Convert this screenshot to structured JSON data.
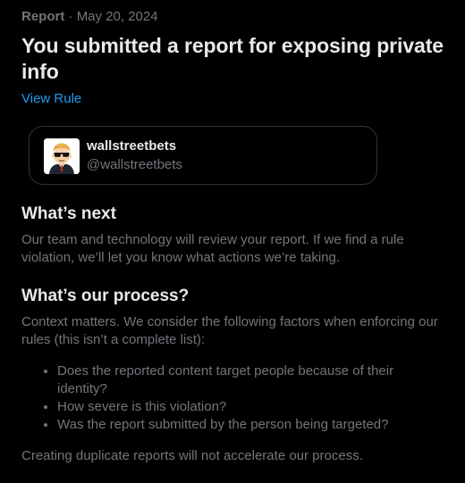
{
  "report": {
    "kind": "Report",
    "separator": " · ",
    "date": "May 20, 2024",
    "title": "You submitted a report for exposing private info",
    "view_rule_label": "View Rule"
  },
  "account": {
    "name": "wallstreetbets",
    "handle": "@wallstreetbets",
    "avatar_icon": "wallstreetbets-mascot-avatar"
  },
  "whats_next": {
    "heading": "What’s next",
    "body": "Our team and technology will review your report. If we find a rule violation, we’ll let you know what actions we’re taking."
  },
  "process": {
    "heading": "What’s our process?",
    "intro": "Context matters. We consider the following factors when enforcing our rules (this isn’t a complete list):",
    "factors": [
      "Does the reported content target people because of their identity?",
      "How severe is this violation?",
      "Was the report submitted by the person being targeted?"
    ],
    "footer": "Creating duplicate reports will not accelerate our process."
  },
  "colors": {
    "background": "#000000",
    "primary_text": "#e7e9ea",
    "secondary_text": "#71767b",
    "link": "#1d9bf0",
    "border": "#2f3336"
  }
}
